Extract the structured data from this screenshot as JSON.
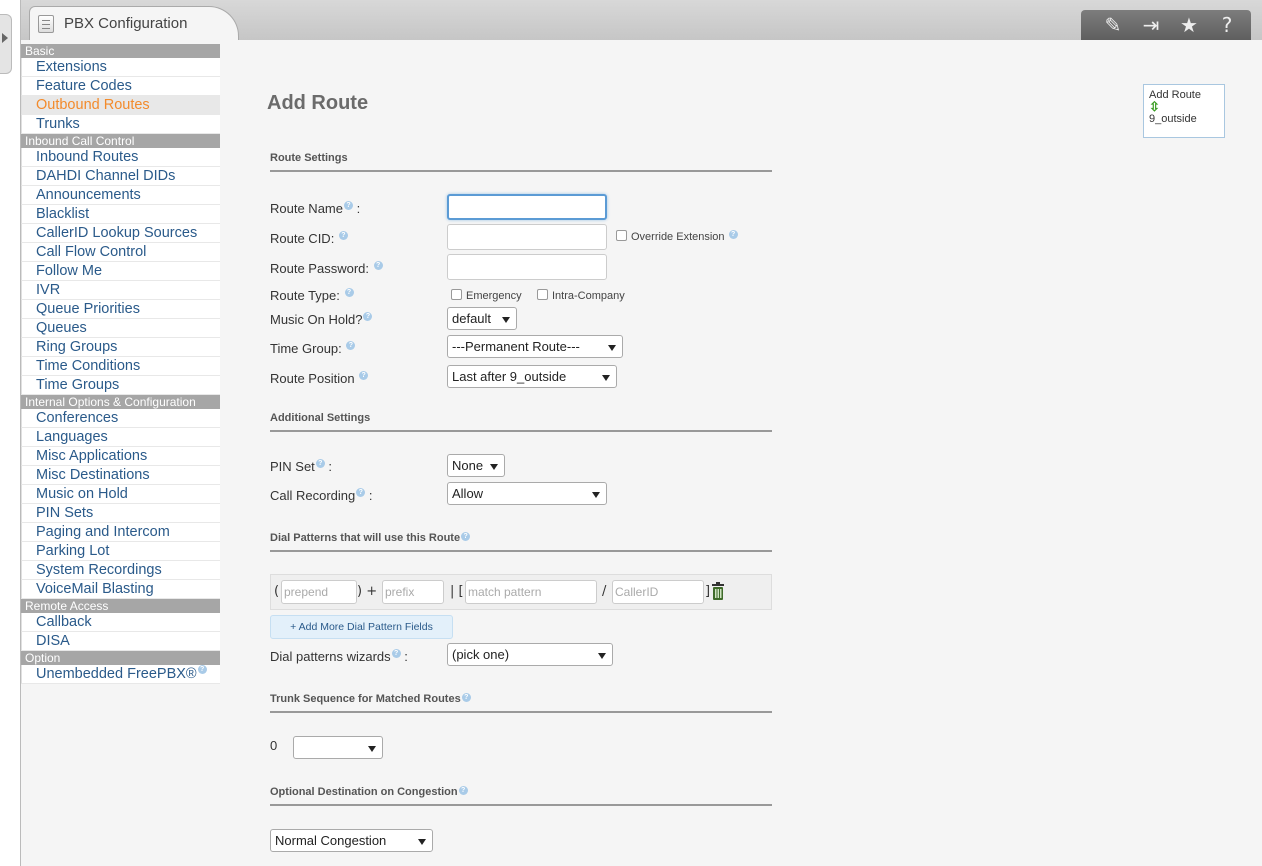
{
  "window": {
    "title": "PBX Configuration",
    "toolbar_icons": [
      "edit-icon",
      "exit-icon",
      "star-icon",
      "help-icon"
    ]
  },
  "sidebar": {
    "sections": [
      {
        "header": "Basic",
        "items": [
          {
            "label": "Extensions"
          },
          {
            "label": "Feature Codes"
          },
          {
            "label": "Outbound Routes",
            "active": true
          },
          {
            "label": "Trunks"
          }
        ]
      },
      {
        "header": "Inbound Call Control",
        "items": [
          {
            "label": "Inbound Routes"
          },
          {
            "label": "DAHDI Channel DIDs"
          },
          {
            "label": "Announcements"
          },
          {
            "label": "Blacklist"
          },
          {
            "label": "CallerID Lookup Sources"
          },
          {
            "label": "Call Flow Control"
          },
          {
            "label": "Follow Me"
          },
          {
            "label": "IVR"
          },
          {
            "label": "Queue Priorities"
          },
          {
            "label": "Queues"
          },
          {
            "label": "Ring Groups"
          },
          {
            "label": "Time Conditions"
          },
          {
            "label": "Time Groups"
          }
        ]
      },
      {
        "header": "Internal Options & Configuration",
        "items": [
          {
            "label": "Conferences"
          },
          {
            "label": "Languages"
          },
          {
            "label": "Misc Applications"
          },
          {
            "label": "Misc Destinations"
          },
          {
            "label": "Music on Hold"
          },
          {
            "label": "PIN Sets"
          },
          {
            "label": "Paging and Intercom"
          },
          {
            "label": "Parking Lot"
          },
          {
            "label": "System Recordings"
          },
          {
            "label": "VoiceMail Blasting"
          }
        ]
      },
      {
        "header": "Remote Access",
        "items": [
          {
            "label": "Callback"
          },
          {
            "label": "DISA"
          }
        ]
      },
      {
        "header": "Option",
        "items": [
          {
            "label": "Unembedded FreePBX®"
          }
        ]
      }
    ]
  },
  "main": {
    "title": "Add Route",
    "route_settings": {
      "heading": "Route Settings",
      "route_name_label": "Route Name",
      "route_name_colon": ":",
      "route_name_value": "",
      "route_cid_label": "Route CID:",
      "route_cid_value": "",
      "override_extension_label": "Override Extension",
      "route_password_label": "Route Password:",
      "route_password_value": "",
      "route_type_label": "Route Type:",
      "emergency_label": "Emergency",
      "intra_company_label": "Intra-Company",
      "moh_label": "Music On Hold?",
      "moh_value": "default",
      "time_group_label": "Time Group:",
      "time_group_value": "---Permanent Route---",
      "route_position_label": "Route Position",
      "route_position_value": "Last after 9_outside"
    },
    "additional_settings": {
      "heading": "Additional Settings",
      "pin_set_label": "PIN Set",
      "pin_set_colon": ":",
      "pin_set_value": "None",
      "call_recording_label": "Call Recording",
      "call_recording_colon": ":",
      "call_recording_value": "Allow"
    },
    "dial_patterns": {
      "heading": "Dial Patterns that will use this Route",
      "open_paren": "(",
      "prepend_placeholder": "prepend",
      "close_plus": ") +",
      "prefix_placeholder": "prefix",
      "pipe_bracket": "| [",
      "match_placeholder": "match pattern",
      "slash": "/",
      "callerid_placeholder": "CallerID",
      "close_bracket": "]",
      "add_button": "+ Add More Dial Pattern Fields",
      "wizards_label": "Dial patterns wizards",
      "wizards_colon": ":",
      "wizards_value": "(pick one)"
    },
    "trunk_sequence": {
      "heading": "Trunk Sequence for Matched Routes",
      "index": "0",
      "trunk_value": ""
    },
    "congestion": {
      "heading": "Optional Destination on Congestion",
      "value": "Normal Congestion"
    },
    "route_box": {
      "title": "Add Route",
      "route": "9_outside"
    }
  }
}
